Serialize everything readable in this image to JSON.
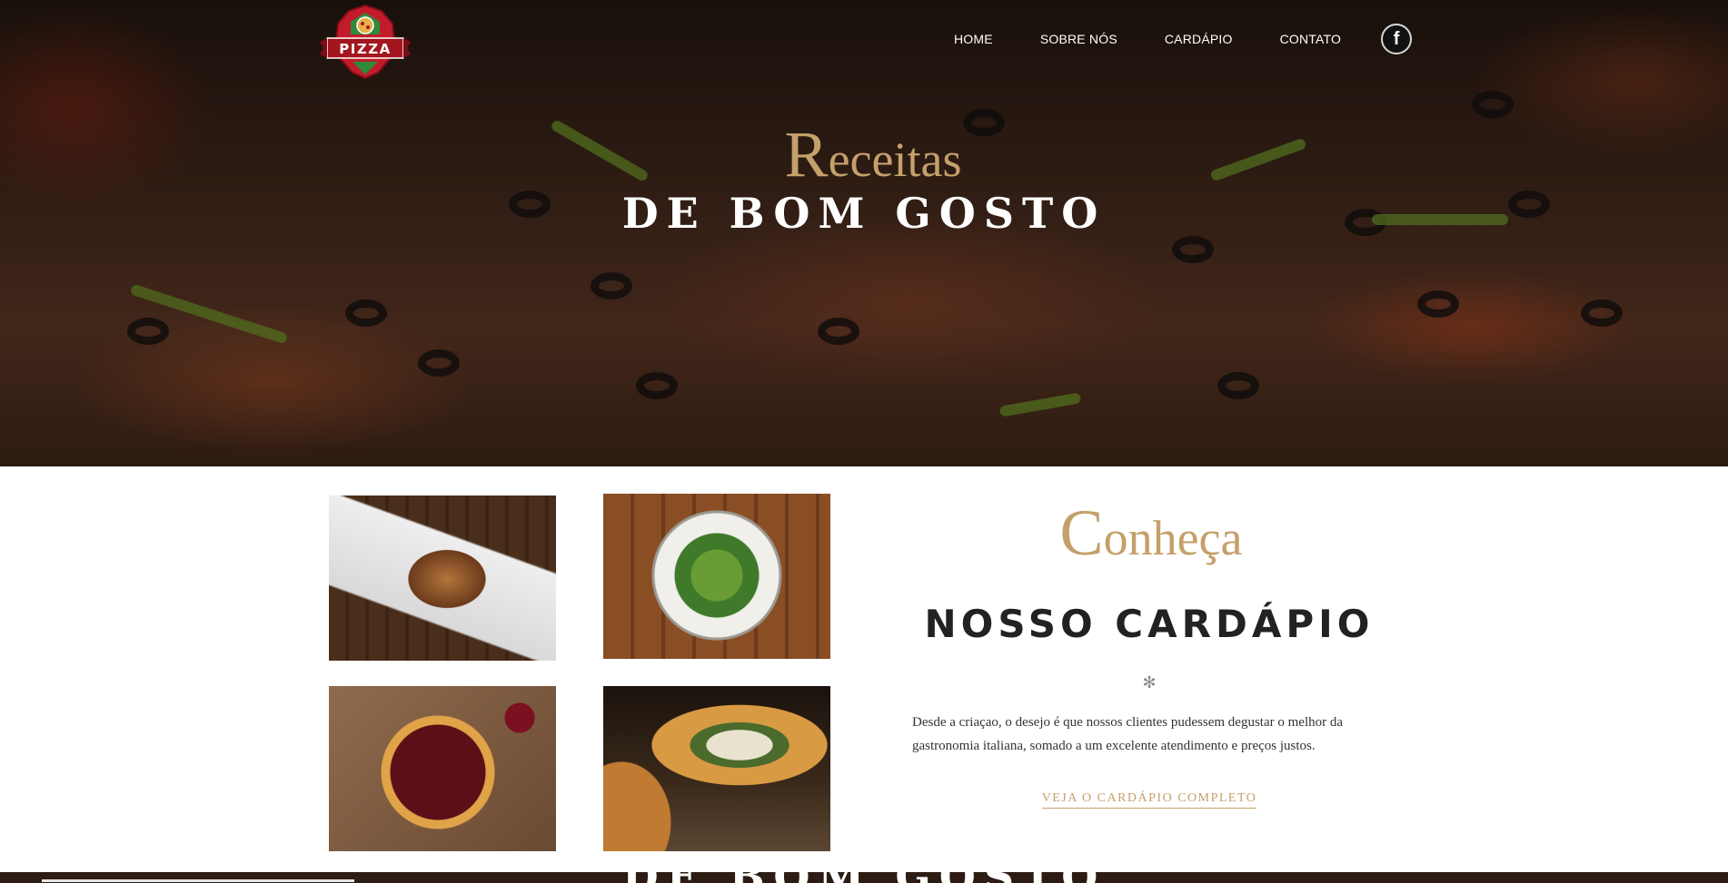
{
  "header": {
    "logo_text": "PIZZA",
    "nav": [
      "HOME",
      "SOBRE NÓS",
      "CARDÁPIO",
      "CONTATO"
    ],
    "social_icon": "facebook-icon",
    "social_label": "f"
  },
  "hero": {
    "script_cap": "R",
    "script_rest": "eceitas",
    "main": "DE BOM GOSTO"
  },
  "gallery": {
    "images": [
      "dessert-photo",
      "salad-photo",
      "pizza-photo",
      "calzone-photo"
    ]
  },
  "intro": {
    "script_cap": "C",
    "script_rest": "onheça",
    "heading": "NOSSO CARDÁPIO",
    "ornament": "✻",
    "description": "Desde a criaçao, o desejo é que nossos clientes pudessem degustar o melhor da gastronomia italiana, somado a um excelente atendimento e preços justos.",
    "cta": "VEJA O CARDÁPIO COMPLETO"
  },
  "footer_peek": {
    "text": "DE BOM GOSTO"
  },
  "colors": {
    "accent_gold": "#c4a06a",
    "heading_dark": "#222222",
    "hero_dark": "#3b241a"
  }
}
